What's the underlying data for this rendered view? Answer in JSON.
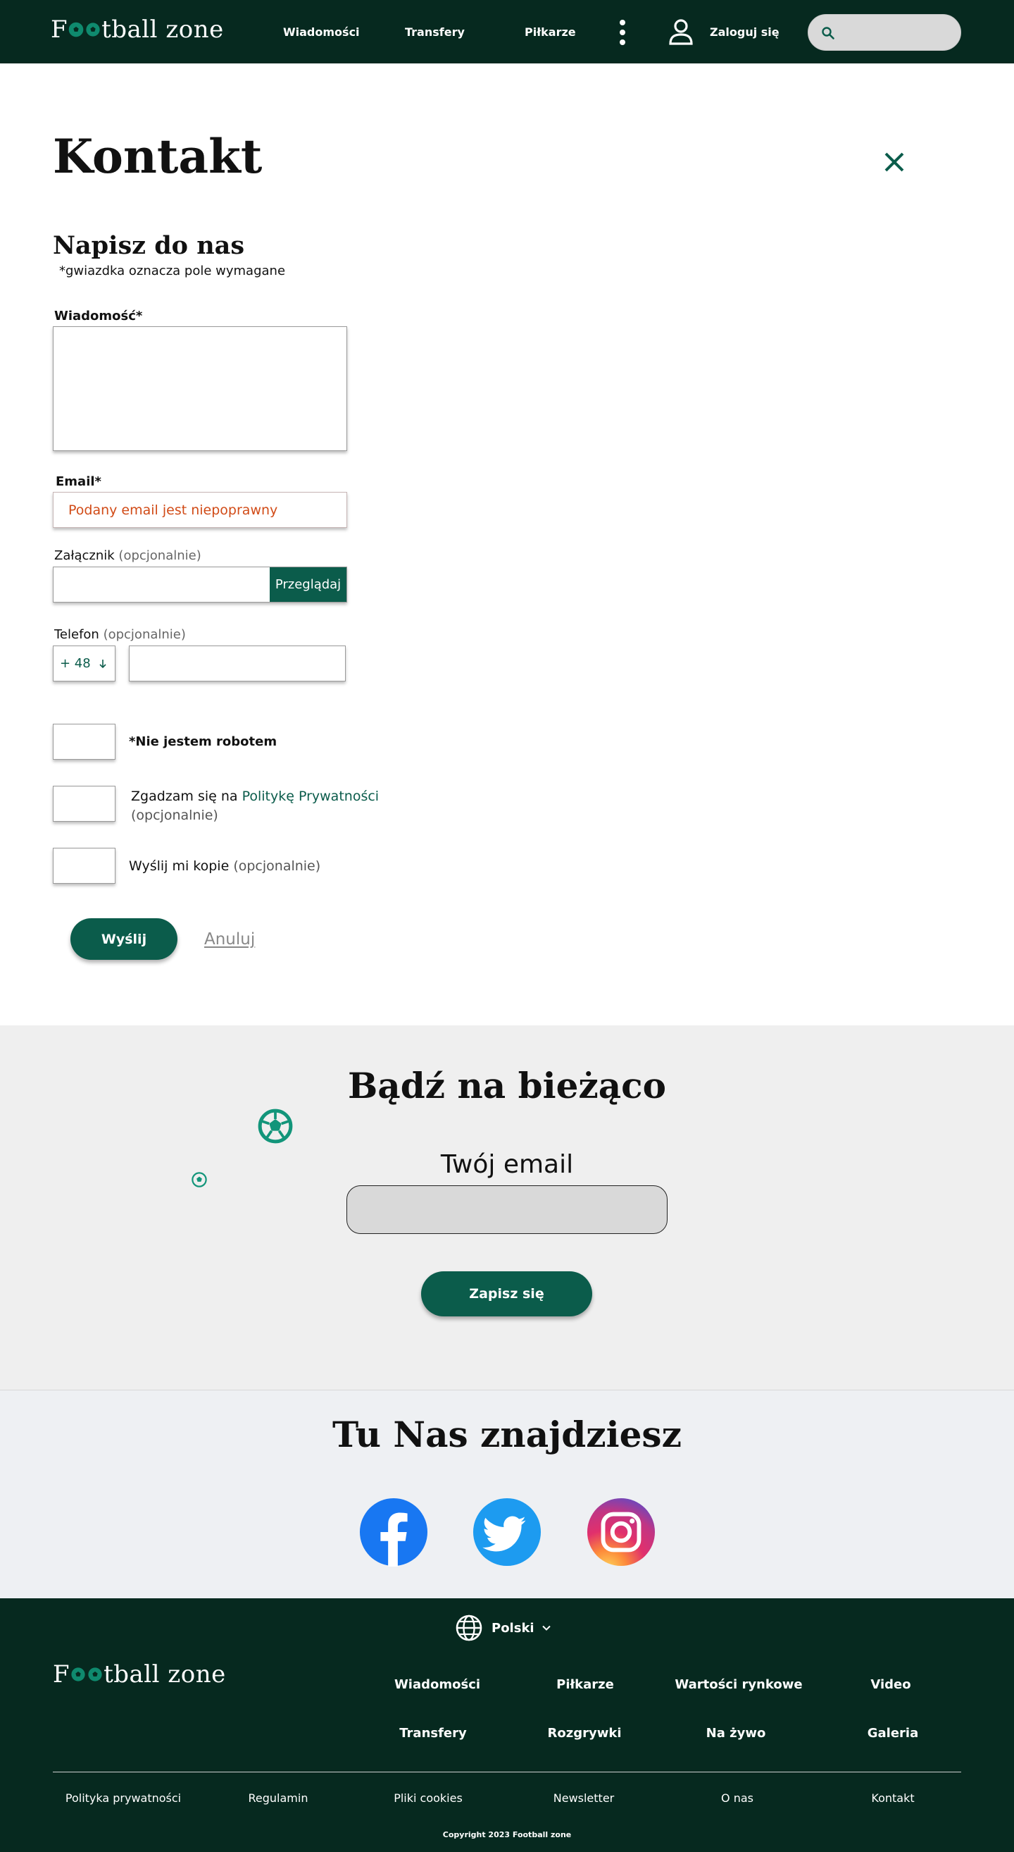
{
  "header": {
    "logo": {
      "before": "F",
      "after": "tball zone"
    },
    "nav": [
      "Wiadomości",
      "Transfery",
      "Piłkarze"
    ],
    "login_label": "Zaloguj się",
    "search_placeholder": ""
  },
  "contact": {
    "title": "Kontakt",
    "form_title": "Napisz do nas",
    "required_note": "*gwiazdka oznacza pole wymagane",
    "message_label": "Wiadomość*",
    "message_value": "",
    "email_label": "Email*",
    "email_error": "Podany email jest niepoprawny",
    "attachment_label": "Załącznik",
    "optional": "(opcjonalnie)",
    "browse_label": "Przeglądaj",
    "phone_label": "Telefon",
    "phone_prefix": "+ 48",
    "robot_label": "*Nie jestem robotem",
    "privacy_before": "Zgadzam się na ",
    "privacy_link": "Politykę Prywatności",
    "copy_label": "Wyślij mi kopie ",
    "send_label": "Wyślij",
    "cancel_label": "Anuluj"
  },
  "newsletter": {
    "title": "Bądź na bieżąco",
    "email_label": "Twój email",
    "subscribe_label": "Zapisz się"
  },
  "social": {
    "title": "Tu Nas znajdziesz",
    "icons": [
      "facebook-icon",
      "twitter-icon",
      "instagram-icon"
    ]
  },
  "footer": {
    "language": "Polski",
    "logo": {
      "before": "F",
      "after": "tball zone"
    },
    "links_row1": [
      "Wiadomości",
      "Piłkarze",
      "Wartości rynkowe",
      "Video"
    ],
    "links_row2": [
      "Transfery",
      "Rozgrywki",
      "Na żywo",
      "Galeria"
    ],
    "bottom_links": [
      "Polityka prywatności",
      "Regulamin",
      "Pliki cookies",
      "Newsletter",
      "O nas",
      "Kontakt"
    ],
    "copyright": "Copyright 2023 Football zone"
  },
  "colors": {
    "header_bg": "#06291f",
    "accent": "#0b5c4b",
    "error": "#d14b17",
    "newsletter_bg": "#efefef",
    "social_bg": "#eef0f3"
  }
}
